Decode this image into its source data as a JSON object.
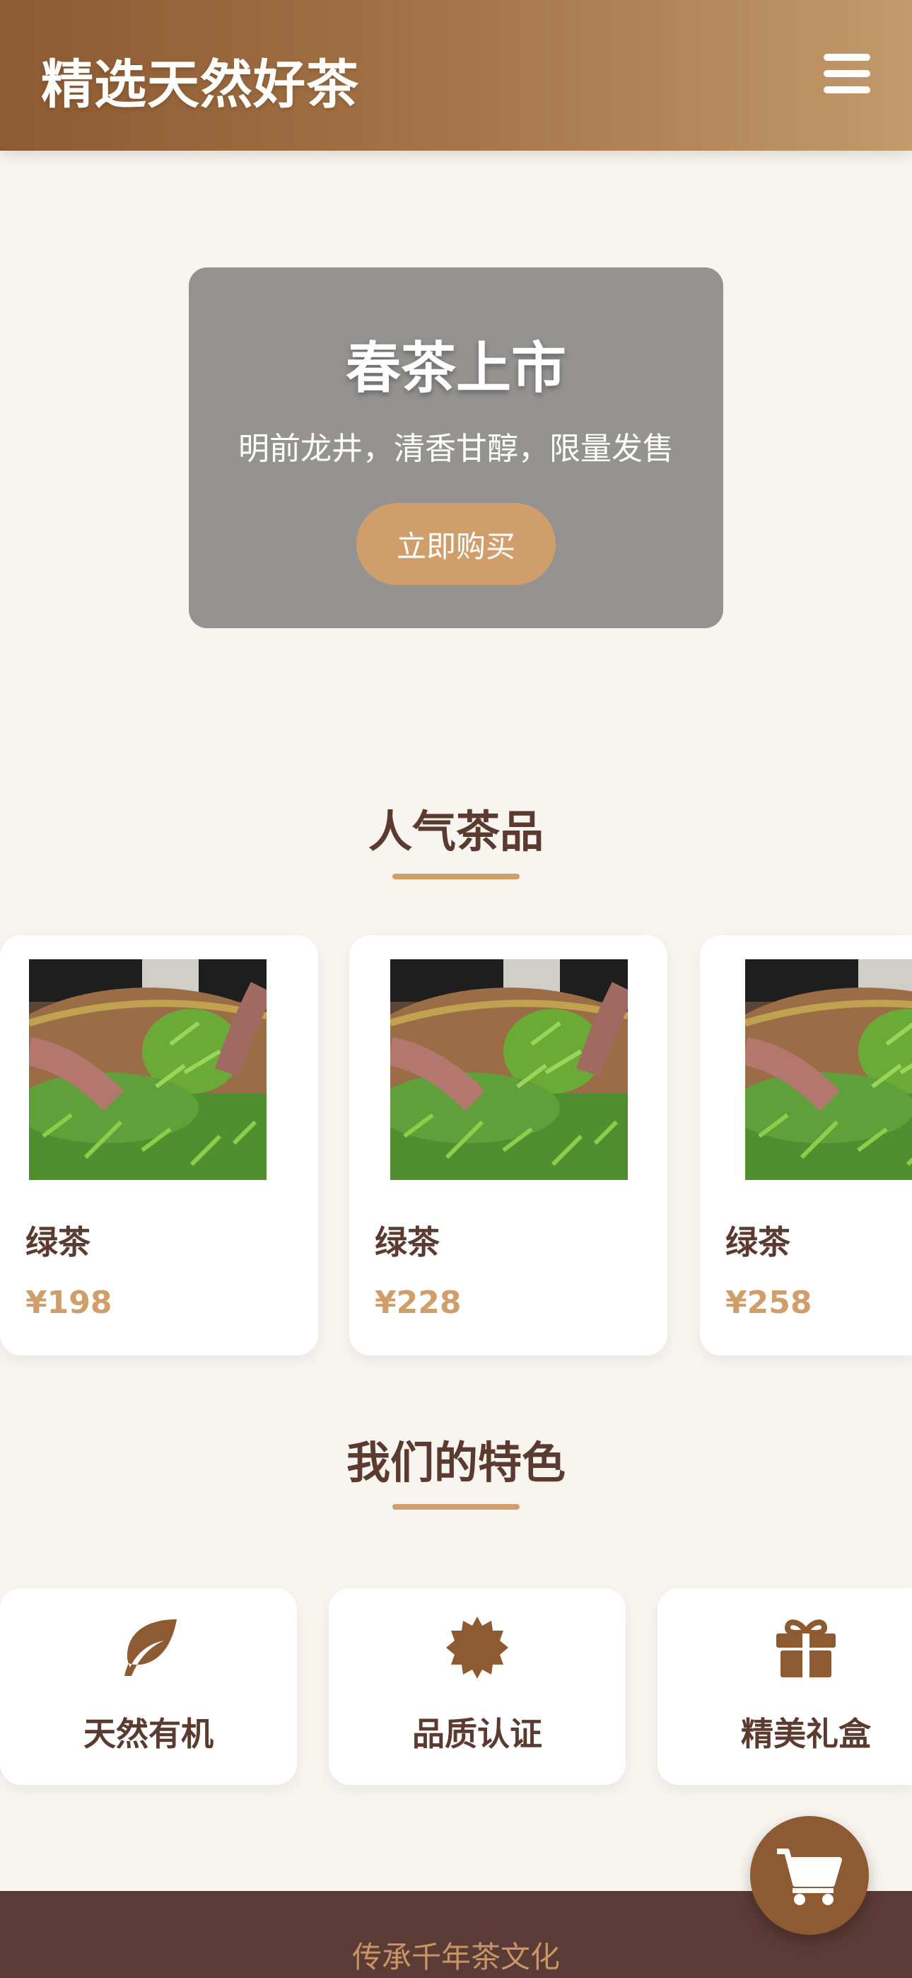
{
  "header": {
    "title": "精选天然好茶"
  },
  "banner": {
    "title": "春茶上市",
    "subtitle": "明前龙井，清香甘醇，限量发售",
    "button_label": "立即购买"
  },
  "popular": {
    "title": "人气茶品",
    "products": [
      {
        "name": "绿茶",
        "price": "¥198"
      },
      {
        "name": "绿茶",
        "price": "¥228"
      },
      {
        "name": "绿茶",
        "price": "¥258"
      }
    ]
  },
  "features": {
    "title": "我们的特色",
    "items": [
      {
        "label": "天然有机",
        "icon": "leaf-icon"
      },
      {
        "label": "品质认证",
        "icon": "certificate-icon"
      },
      {
        "label": "精美礼盒",
        "icon": "gift-icon"
      }
    ]
  },
  "footer": {
    "text": "传承千年茶文化"
  },
  "colors": {
    "brand": "#8d5a31",
    "accent": "#d09e6b",
    "text_dark": "#5b3b30",
    "background": "#f8f5f0"
  }
}
